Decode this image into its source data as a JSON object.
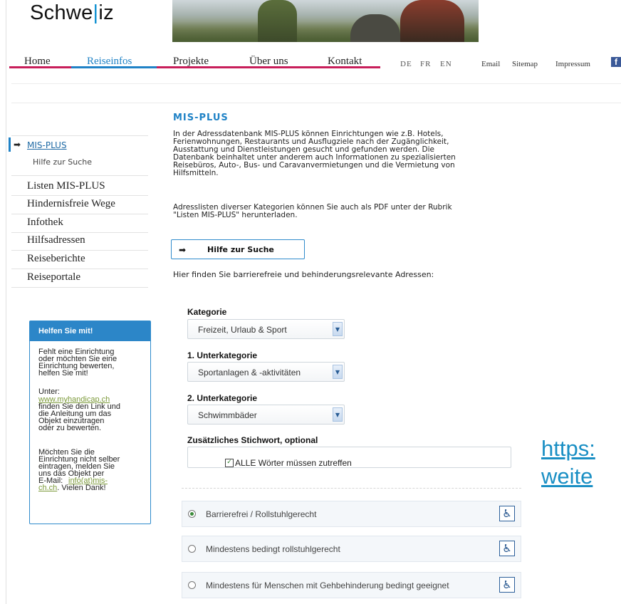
{
  "header": {
    "logo_prefix": "Schwe",
    "logo_bar": "|",
    "logo_suffix": "iz",
    "nav": [
      "Home",
      "Reiseinfos",
      "Projekte",
      "Über uns",
      "Kontakt"
    ],
    "languages": [
      "DE",
      "FR",
      "EN"
    ],
    "utility": [
      "Email",
      "Sitemap",
      "Impressum"
    ],
    "facebook_glyph": "f"
  },
  "sidebar": {
    "active_arrow": "➡",
    "active_label": "MIS-PLUS",
    "sub_label": "Hilfe zur Suche",
    "items": [
      "Listen MIS-PLUS",
      "Hindernisfreie Wege",
      "Infothek",
      "Hilfsadressen",
      "Reiseberichte",
      "Reiseportale"
    ]
  },
  "help_box": {
    "title": "Helfen Sie mit!",
    "text1": "Fehlt eine Einrichtung\noder möchten Sie eine\nEinrichtung bewerten,\nhelfen Sie mit!",
    "text2_prefix": "Unter:",
    "link1": "www.myhandicap.ch",
    "text2_suffix": "finden Sie den Link und\ndie Anleitung um das\nObjekt einzutragen\noder zu bewerten.",
    "text3": "Möchten Sie die\nEinrichtung nicht selber\neintragen, melden Sie\nuns das Objekt per\nE-Mail:",
    "link2a": "info(at)mis-",
    "link2b": "ch.ch",
    "text3_end": ". Vielen Dank!"
  },
  "main": {
    "title": "MIS-PLUS",
    "para1": "In der Adressdatenbank MIS-PLUS können Einrichtungen wie z.B. Hotels,\nFerienwohnungen, Restaurants und Ausflugziele nach der Zugänglichkeit,\nAusstattung und Dienstleistungen gesucht und gefunden werden. Die\nDatenbank beinhaltet unter anderem auch Informationen zu spezialisierten\nReisebüros, Auto-, Bus- und Caravanvermietungen und die Vermietung von\nHilfsmitteln.",
    "para2": "Adresslisten diverser Kategorien können Sie auch als PDF unter der Rubrik\n\"Listen MIS-PLUS\" herunterladen.",
    "help_button_arrow": "➡",
    "help_button_label": "Hilfe zur Suche",
    "intro": "Hier finden Sie barrierefreie und behinderungsrelevante Adressen:"
  },
  "form": {
    "kategorie_label": "Kategorie",
    "kategorie_value": "Freizeit, Urlaub & Sport",
    "unter1_label": "1. Unterkategorie",
    "unter1_value": "Sportanlagen & -aktivitäten",
    "unter2_label": "2. Unterkategorie",
    "unter2_value": "Schwimmbäder",
    "keyword_label": "Zusätzliches Stichwort, optional",
    "keyword_value": "",
    "all_words_label": "ALLE Wörter müssen zutreffen",
    "all_words_checked": true
  },
  "options": [
    {
      "label": "Barrierefrei / Rollstuhlgerecht",
      "selected": true
    },
    {
      "label": "Mindestens bedingt rollstuhlgerecht",
      "selected": false
    },
    {
      "label": "Mindestens für Menschen mit Gehbehinderung bedingt geeignet",
      "selected": false
    }
  ],
  "overlay": {
    "line1": "https:",
    "line2": "weite"
  }
}
